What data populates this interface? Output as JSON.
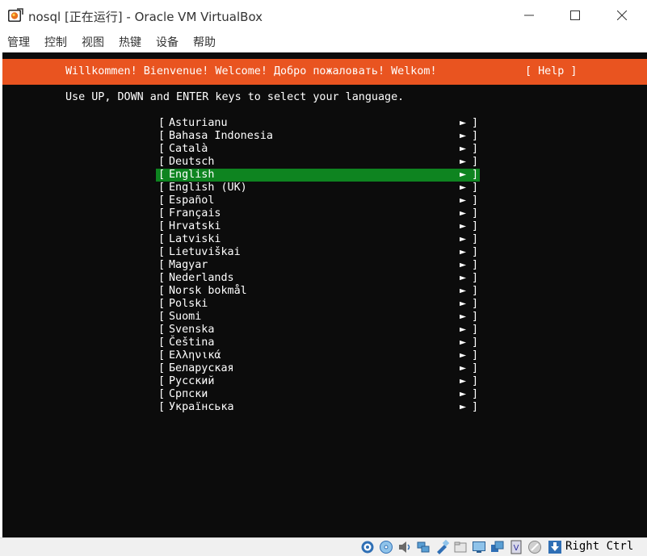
{
  "window": {
    "title": "nosql [正在运行] - Oracle VM VirtualBox",
    "app_icon": "virtualbox-icon",
    "controls": [
      "minimize-icon",
      "maximize-icon",
      "close-icon"
    ]
  },
  "menu": {
    "items": [
      "管理",
      "控制",
      "视图",
      "热键",
      "设备",
      "帮助"
    ]
  },
  "installer": {
    "welcome": "Willkommen! Bienvenue! Welcome! Добро пожаловать! Welkom!",
    "help": "[ Help ]",
    "instruction": "Use UP, DOWN and ENTER keys to select your language.",
    "bracket_open": "[",
    "bracket_close": "]",
    "arrow": "►",
    "selected_language": "English",
    "languages": [
      "Asturianu",
      "Bahasa Indonesia",
      "Català",
      "Deutsch",
      "English",
      "English (UK)",
      "Español",
      "Français",
      "Hrvatski",
      "Latviski",
      "Lietuviškai",
      "Magyar",
      "Nederlands",
      "Norsk bokmål",
      "Polski",
      "Suomi",
      "Svenska",
      "Čeština",
      "Ελληνικά",
      "Беларуская",
      "Русский",
      "Српски",
      "Українська"
    ]
  },
  "colors": {
    "header_bg": "#e95420",
    "selection_bg": "#0e8420",
    "console_bg": "#0c0c0c",
    "text": "#ffffff"
  },
  "statusbar": {
    "icons": [
      "hard-disk-icon",
      "optical-drive-icon",
      "audio-icon",
      "network-icon",
      "usb-icon",
      "shared-folders-icon",
      "display-icon",
      "video-capture-icon",
      "cpu-icon",
      "mouse-integration-icon",
      "keyboard-capture-icon"
    ],
    "host_key": "Right Ctrl"
  }
}
